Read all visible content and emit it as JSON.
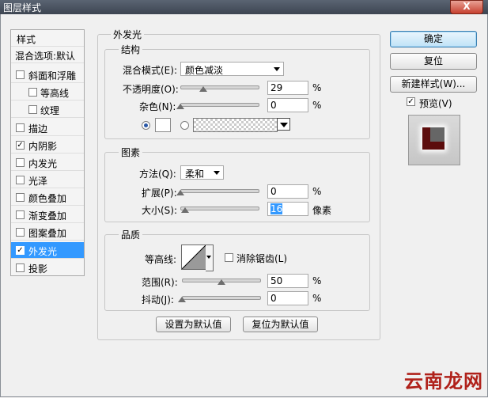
{
  "window": {
    "title": "图层样式",
    "close_label": "X"
  },
  "style_list": {
    "header": "样式",
    "blend_defaults": "混合选项:默认",
    "items": [
      {
        "label": "斜面和浮雕",
        "checked": false
      },
      {
        "label": "等高线",
        "checked": false
      },
      {
        "label": "纹理",
        "checked": false
      },
      {
        "label": "描边",
        "checked": false
      },
      {
        "label": "内阴影",
        "checked": true
      },
      {
        "label": "内发光",
        "checked": false
      },
      {
        "label": "光泽",
        "checked": false
      },
      {
        "label": "颜色叠加",
        "checked": false
      },
      {
        "label": "渐变叠加",
        "checked": false
      },
      {
        "label": "图案叠加",
        "checked": false
      },
      {
        "label": "外发光",
        "checked": true
      },
      {
        "label": "投影",
        "checked": false
      }
    ]
  },
  "outer_glow": {
    "title": "外发光",
    "structure": {
      "title": "结构",
      "blend_mode_label": "混合模式(E):",
      "blend_mode_value": "颜色减淡",
      "opacity_label": "不透明度(O):",
      "opacity_value": "29",
      "opacity_unit": "%",
      "opacity_level": 29,
      "noise_label": "杂色(N):",
      "noise_value": "0",
      "noise_unit": "%",
      "noise_level": 0,
      "glow_color": "#ffffff"
    },
    "elements": {
      "title": "图素",
      "method_label": "方法(Q):",
      "method_value": "柔和",
      "spread_label": "扩展(P):",
      "spread_value": "0",
      "spread_unit": "%",
      "spread_level": 0,
      "size_label": "大小(S):",
      "size_value": "16",
      "size_unit": "像素",
      "size_level": 6
    },
    "quality": {
      "title": "品质",
      "contour_label": "等高线:",
      "antialias_label": "消除锯齿(L)",
      "antialias_checked": false,
      "range_label": "范围(R):",
      "range_value": "50",
      "range_unit": "%",
      "range_level": 50,
      "jitter_label": "抖动(J):",
      "jitter_value": "0",
      "jitter_unit": "%",
      "jitter_level": 0
    },
    "make_default_label": "设置为默认值",
    "reset_default_label": "复位为默认值"
  },
  "buttons": {
    "ok": "确定",
    "reset": "复位",
    "new_style": "新建样式(W)...",
    "preview_label": "预览(V)",
    "preview_checked": true
  },
  "watermark": "云南龙网"
}
